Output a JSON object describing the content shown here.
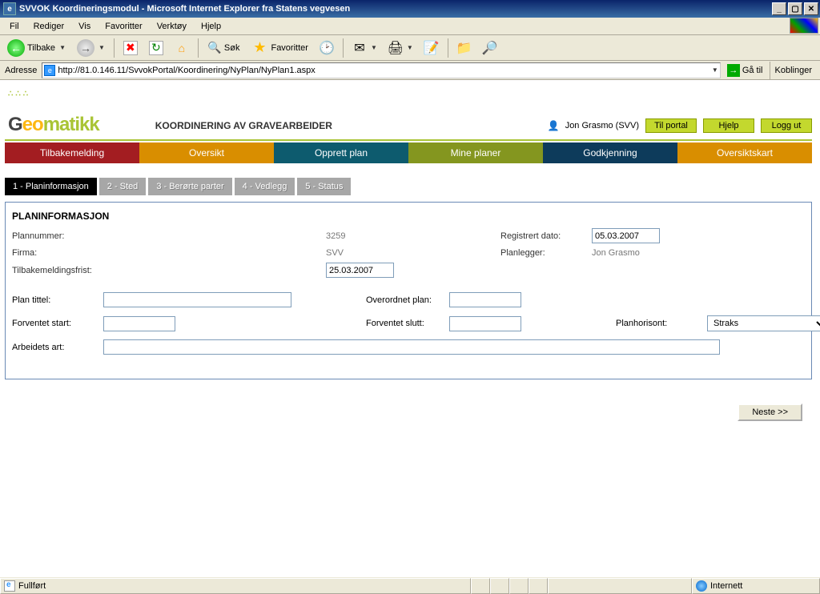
{
  "window": {
    "title": "SVVOK Koordineringsmodul - Microsoft Internet Explorer fra Statens vegvesen"
  },
  "menu": {
    "items": [
      "Fil",
      "Rediger",
      "Vis",
      "Favoritter",
      "Verktøy",
      "Hjelp"
    ]
  },
  "toolbar": {
    "back": "Tilbake",
    "search": "Søk",
    "favorites": "Favoritter"
  },
  "address": {
    "label": "Adresse",
    "url": "http://81.0.146.11/SvvokPortal/Koordinering/NyPlan/NyPlan1.aspx",
    "go": "Gå til",
    "links": "Koblinger"
  },
  "header": {
    "title": "KOORDINERING AV GRAVEARBEIDER",
    "user": "Jon Grasmo (SVV)",
    "btn_portal": "Til portal",
    "btn_help": "Hjelp",
    "btn_logout": "Logg ut"
  },
  "maintabs": {
    "t1": "Tilbakemelding",
    "t2": "Oversikt",
    "t3": "Opprett plan",
    "t4": "Mine planer",
    "t5": "Godkjenning",
    "t6": "Oversiktskart"
  },
  "subtabs": {
    "s1": "1 - Planinformasjon",
    "s2": "2 - Sted",
    "s3": "3 - Berørte parter",
    "s4": "4 - Vedlegg",
    "s5": "5 - Status"
  },
  "form": {
    "heading": "PLANINFORMASJON",
    "plannummer_lbl": "Plannummer:",
    "plannummer_val": "3259",
    "regdato_lbl": "Registrert dato:",
    "regdato_val": "05.03.2007",
    "firma_lbl": "Firma:",
    "firma_val": "SVV",
    "planlegger_lbl": "Planlegger:",
    "planlegger_val": "Jon Grasmo",
    "frist_lbl": "Tilbakemeldingsfrist:",
    "frist_val": "25.03.2007",
    "tittel_lbl": "Plan tittel:",
    "overordnet_lbl": "Overordnet plan:",
    "start_lbl": "Forventet start:",
    "slutt_lbl": "Forventet slutt:",
    "horisont_lbl": "Planhorisont:",
    "horisont_val": "Straks",
    "arbeid_lbl": "Arbeidets art:"
  },
  "buttons": {
    "next": "Neste >>"
  },
  "status": {
    "left": "Fullført",
    "zone": "Internett"
  }
}
